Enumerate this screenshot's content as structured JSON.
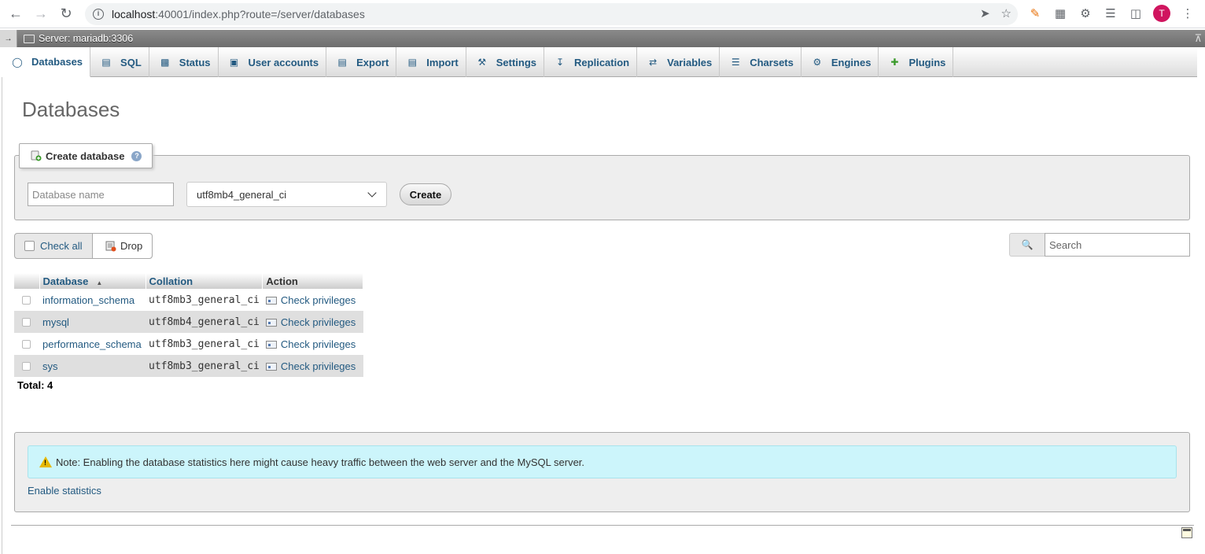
{
  "browser": {
    "url_host": "localhost",
    "url_rest": ":40001/index.php?route=/server/databases",
    "avatar_letter": "T"
  },
  "server_bar": {
    "label": "Server: mariadb:3306"
  },
  "tabs": [
    {
      "label": "Databases",
      "icon": "database-icon"
    },
    {
      "label": "SQL",
      "icon": "sql-icon"
    },
    {
      "label": "Status",
      "icon": "status-icon"
    },
    {
      "label": "User accounts",
      "icon": "user-accounts-icon"
    },
    {
      "label": "Export",
      "icon": "export-icon"
    },
    {
      "label": "Import",
      "icon": "import-icon"
    },
    {
      "label": "Settings",
      "icon": "wrench-icon"
    },
    {
      "label": "Replication",
      "icon": "replication-icon"
    },
    {
      "label": "Variables",
      "icon": "variables-icon"
    },
    {
      "label": "Charsets",
      "icon": "charsets-icon"
    },
    {
      "label": "Engines",
      "icon": "engines-icon"
    },
    {
      "label": "Plugins",
      "icon": "puzzle-icon"
    }
  ],
  "page_title": "Databases",
  "create_db": {
    "legend": "Create database",
    "name_placeholder": "Database name",
    "collation_selected": "utf8mb4_general_ci",
    "create_label": "Create"
  },
  "toolbar": {
    "check_all_label": "Check all",
    "drop_label": "Drop",
    "search_placeholder": "Search"
  },
  "table": {
    "columns": [
      "Database",
      "Collation",
      "Action"
    ],
    "rows": [
      {
        "name": "information_schema",
        "collation": "utf8mb3_general_ci",
        "action": "Check privileges"
      },
      {
        "name": "mysql",
        "collation": "utf8mb4_general_ci",
        "action": "Check privileges"
      },
      {
        "name": "performance_schema",
        "collation": "utf8mb3_general_ci",
        "action": "Check privileges"
      },
      {
        "name": "sys",
        "collation": "utf8mb3_general_ci",
        "action": "Check privileges"
      }
    ],
    "total_label": "Total: 4"
  },
  "stats": {
    "note": "Note: Enabling the database statistics here might cause heavy traffic between the web server and the MySQL server.",
    "enable_label": "Enable statistics"
  },
  "colors": {
    "link": "#235a81",
    "note_bg": "#ccf5fb",
    "fieldset_bg": "#eeeeee"
  }
}
